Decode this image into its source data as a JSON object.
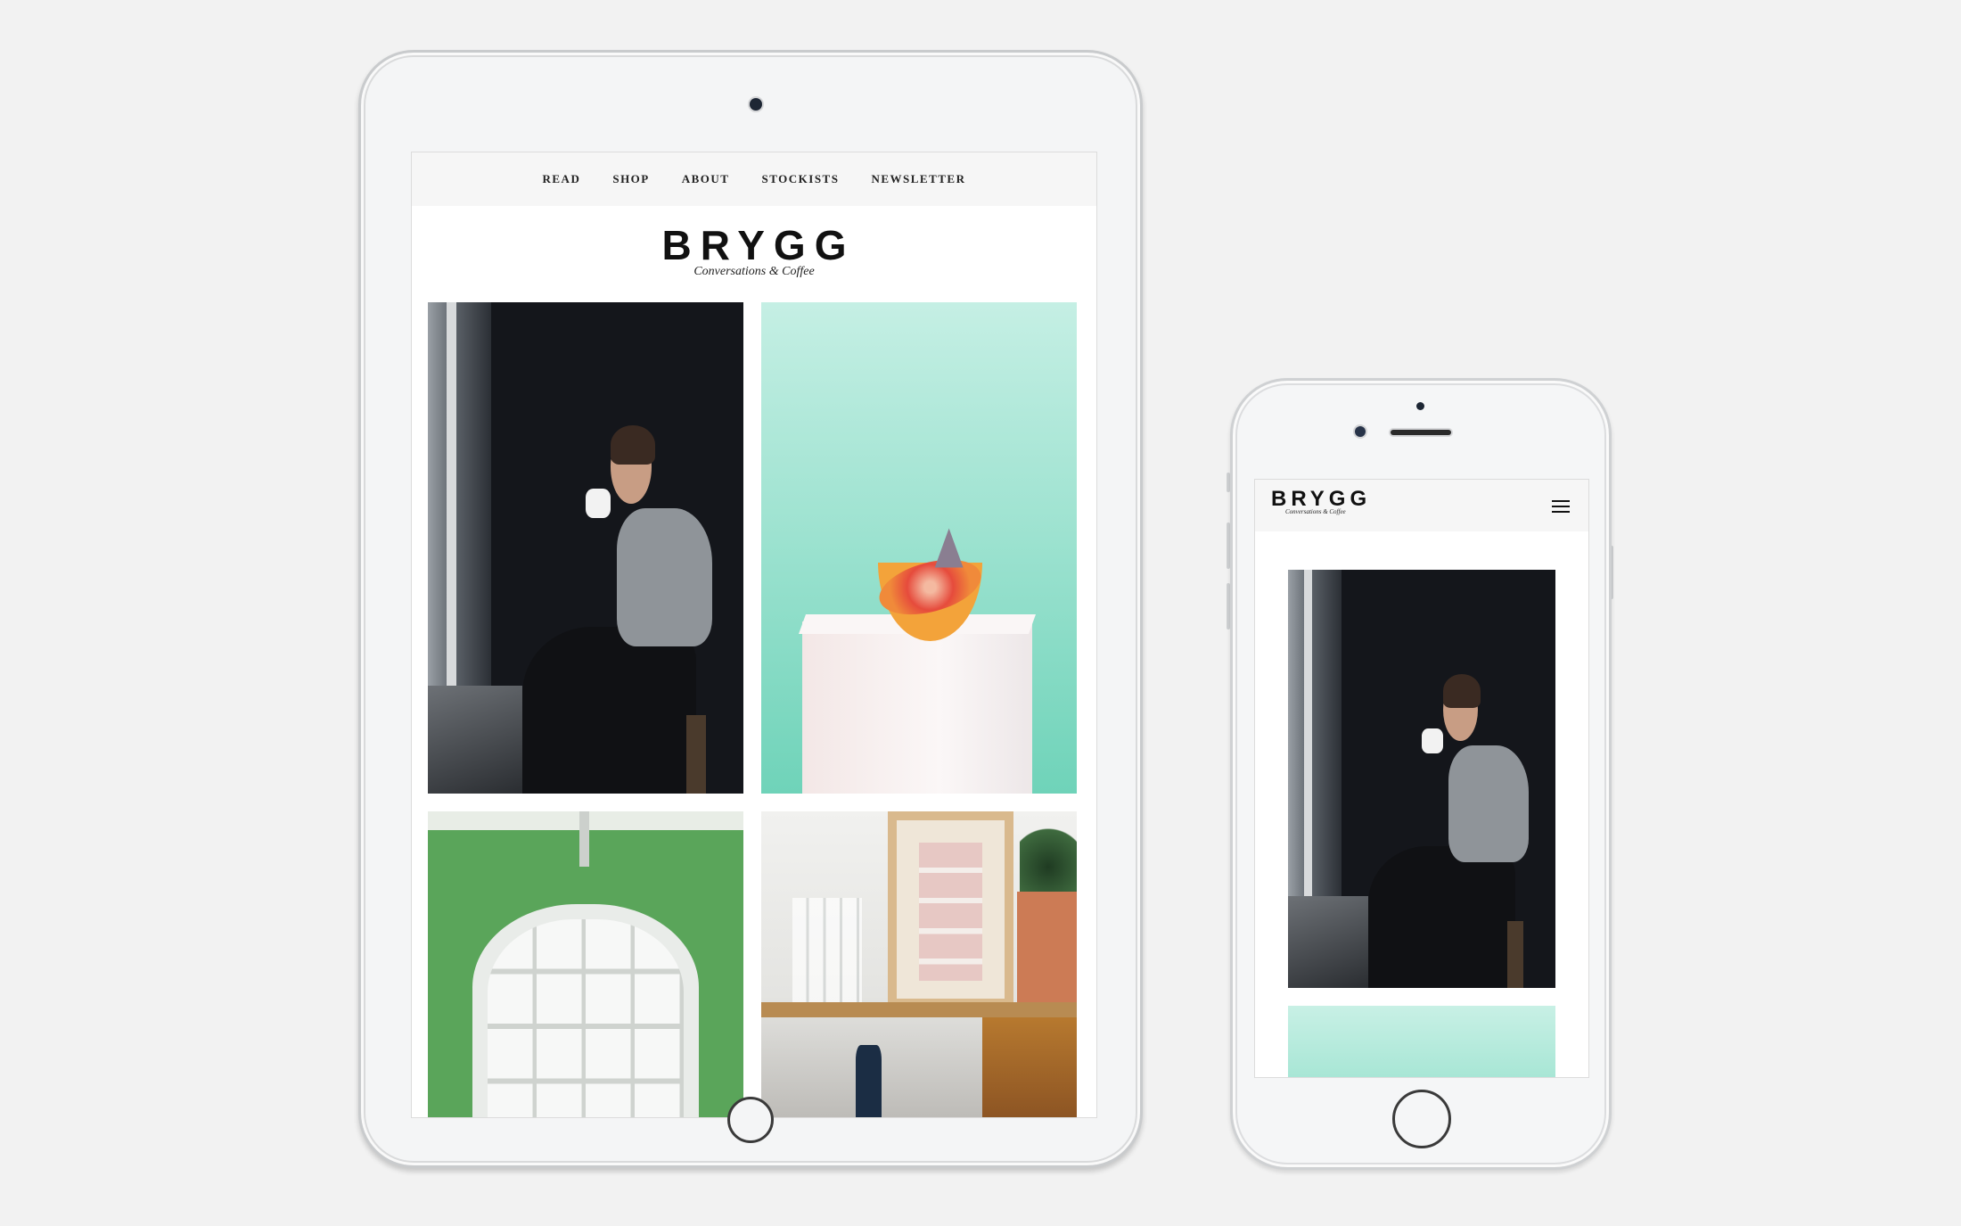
{
  "brand": {
    "name": "BRYGG",
    "tagline": "Conversations & Coffee"
  },
  "nav": {
    "items": [
      {
        "label": "READ"
      },
      {
        "label": "SHOP"
      },
      {
        "label": "ABOUT"
      },
      {
        "label": "STOCKISTS"
      },
      {
        "label": "NEWSLETTER"
      }
    ]
  },
  "photos": [
    {
      "name": "woman-drinking-coffee-photo"
    },
    {
      "name": "grapefruit-on-pedestal-photo"
    },
    {
      "name": "green-room-arched-window-photo"
    },
    {
      "name": "kitchen-shelf-photo"
    }
  ],
  "icons": {
    "menu": "hamburger-menu-icon"
  },
  "colors": {
    "page_background": "#f2f2f2",
    "device_body": "#f4f5f6",
    "mint_accent": "#9fe3d1",
    "green_wall": "#5aa55a"
  }
}
